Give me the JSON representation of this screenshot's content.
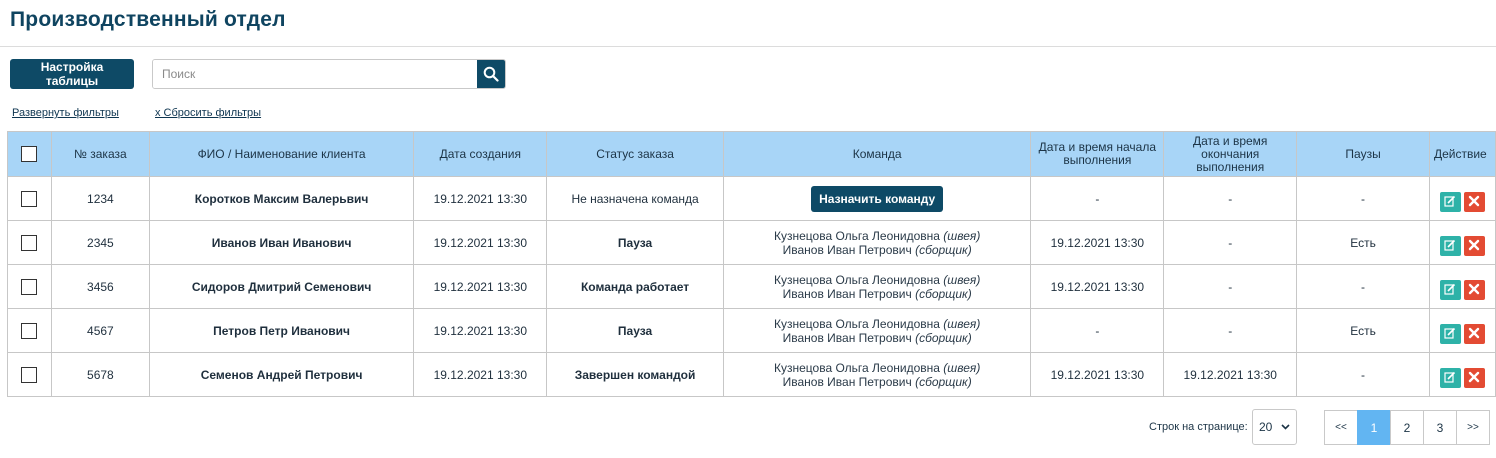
{
  "page": {
    "title": "Производственный отдел"
  },
  "toolbar": {
    "settings_label": "Настройка таблицы",
    "search_placeholder": "Поиск",
    "search_icon": "search-icon"
  },
  "filters": {
    "expand_label": "Развернуть фильтры",
    "reset_label": "x Сбросить фильтры"
  },
  "table": {
    "headers": {
      "order_no": "№ заказа",
      "client": "ФИО / Наименование клиента",
      "created": "Дата создания",
      "status": "Статус заказа",
      "team": "Команда",
      "start": "Дата и время начала выполнения",
      "end": "Дата и время окончания выполнения",
      "pauses": "Паузы",
      "action": "Действие"
    },
    "rows": [
      {
        "order_no": "1234",
        "client": "Коротков Максим Валерьвич",
        "created": "19.12.2021 13:30",
        "status": "Не назначена команда",
        "status_color": "#d9412f",
        "assign_label": "Назначить команду",
        "start": "-",
        "end": "-",
        "pauses": "-"
      },
      {
        "order_no": "2345",
        "client": "Иванов Иван Иванович",
        "created": "19.12.2021 13:30",
        "status": "Пауза",
        "team": [
          {
            "name": "Кузнецова Ольга Леонидовна",
            "role": "(швея)"
          },
          {
            "name": "Иванов Иван Петрович",
            "role": "(сборщик)"
          }
        ],
        "start": "19.12.2021 13:30",
        "end": "-",
        "pauses": "Есть"
      },
      {
        "order_no": "3456",
        "client": "Сидоров Дмитрий Семенович",
        "created": "19.12.2021 13:30",
        "status": "Команда работает",
        "status_color": "#1f8a2a",
        "team": [
          {
            "name": "Кузнецова Ольга Леонидовна",
            "role": "(швея)"
          },
          {
            "name": "Иванов Иван Петрович",
            "role": "(сборщик)"
          }
        ],
        "start": "19.12.2021 13:30",
        "end": "-",
        "pauses": "-"
      },
      {
        "order_no": "4567",
        "client": "Петров Петр Иванович",
        "created": "19.12.2021 13:30",
        "status": "Пауза",
        "team": [
          {
            "name": "Кузнецова Ольга Леонидовна",
            "role": "(швея)"
          },
          {
            "name": "Иванов Иван Петрович",
            "role": "(сборщик)"
          }
        ],
        "start": "-",
        "end": "-",
        "pauses": "Есть"
      },
      {
        "order_no": "5678",
        "client": "Семенов Андрей Петрович",
        "created": "19.12.2021 13:30",
        "status": "Завершен командой",
        "status_color": "#1f8a2a",
        "team": [
          {
            "name": "Кузнецова Ольга Леонидовна",
            "role": "(швея)"
          },
          {
            "name": "Иванов Иван Петрович",
            "role": "(сборщик)"
          }
        ],
        "start": "19.12.2021 13:30",
        "end": "19.12.2021 13:30",
        "pauses": "-"
      }
    ],
    "action_icons": {
      "edit": "edit-icon",
      "delete": "close-icon"
    }
  },
  "pagination": {
    "rows_label": "Строк на странице:",
    "rows_per_page": "20",
    "first": "<<",
    "pages": [
      "1",
      "2",
      "3"
    ],
    "active_page": "1",
    "next": ">>"
  },
  "colors": {
    "primary": "#0e4a66",
    "header_bg": "#a8d5f7",
    "active_page": "#62b5f2",
    "edit": "#2eb2a8",
    "delete": "#e34b33"
  }
}
